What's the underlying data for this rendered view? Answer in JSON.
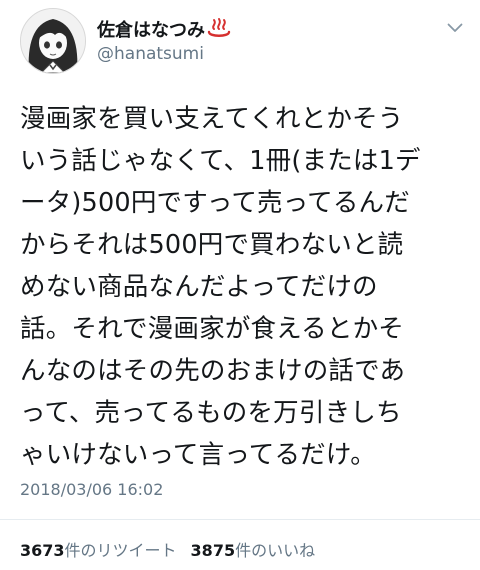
{
  "user": {
    "name": "佐倉はなつみ",
    "handle": "@hanatsumi"
  },
  "tweet": {
    "lines": [
      "漫画家を買い支えてくれとかそう",
      "いう話じゃなくて、1冊(または1デ",
      "ータ)500円ですって売ってるんだ",
      "からそれは500円で買わないと読",
      "めない商品なんだよってだけの",
      "話。それで漫画家が食えるとかそ",
      "んなのはその先のおまけの話であ",
      "って、売ってるものを万引きしち",
      "ゃいけないって言ってるだけ。"
    ],
    "timestamp": "2018/03/06 16:02"
  },
  "stats": {
    "retweets_count": "3673",
    "retweets_label": "件のリツイート",
    "likes_count": "3875",
    "likes_label": "件のいいね"
  },
  "icons": {
    "name_suffix": "hot-spring-icon",
    "menu": "chevron-down-icon"
  }
}
